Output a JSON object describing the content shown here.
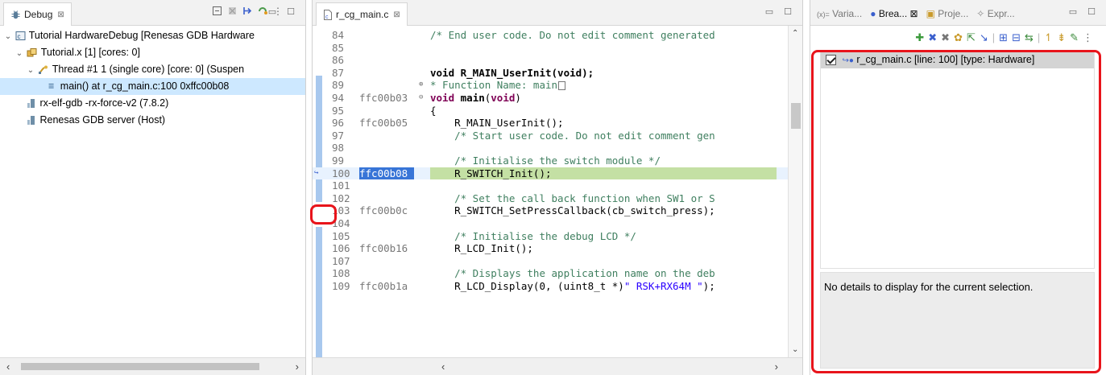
{
  "debug_view": {
    "tab_label": "Debug",
    "tab_close": "⊠",
    "toolbar_icons": [
      "collapse-all-icon",
      "remove-terminated-icon",
      "step-filters-icon",
      "connect-icon",
      "view-menu-icon"
    ],
    "tree": [
      {
        "label": "Tutorial HardwareDebug [Renesas GDB Hardware",
        "level": 0,
        "expanded": true,
        "icon": "launch-config-icon"
      },
      {
        "label": "Tutorial.x [1] [cores: 0]",
        "level": 1,
        "expanded": true,
        "icon": "process-icon"
      },
      {
        "label": "Thread #1 1 (single core) [core: 0] (Suspen",
        "level": 2,
        "expanded": true,
        "icon": "thread-icon"
      },
      {
        "label": "main() at r_cg_main.c:100 0xffc00b08",
        "level": 3,
        "selected": true,
        "icon": "stack-frame-icon"
      },
      {
        "label": "rx-elf-gdb -rx-force-v2 (7.8.2)",
        "level": 1,
        "icon": "debugger-process-icon"
      },
      {
        "label": "Renesas GDB server (Host)",
        "level": 1,
        "icon": "server-process-icon"
      }
    ]
  },
  "editor": {
    "tab_label": "r_cg_main.c",
    "tab_close": "⊠",
    "lines": [
      {
        "num": "84",
        "addr": "",
        "code": "/* End user code. Do not edit comment generated",
        "kind": "comment"
      },
      {
        "num": "85",
        "addr": "",
        "code": "",
        "kind": "plain"
      },
      {
        "num": "86",
        "addr": "",
        "code": "",
        "kind": "plain"
      },
      {
        "num": "87",
        "addr": "",
        "code": "void R_MAIN_UserInit(void);",
        "kind": "decl"
      },
      {
        "num": "89",
        "addr": "",
        "code": "* Function Name: main",
        "kind": "folded"
      },
      {
        "num": "94",
        "addr": "ffc00b03",
        "code": "void main(void)",
        "kind": "main"
      },
      {
        "num": "95",
        "addr": "",
        "code": "{",
        "kind": "plain"
      },
      {
        "num": "96",
        "addr": "ffc00b05",
        "code": "    R_MAIN_UserInit();",
        "kind": "plain"
      },
      {
        "num": "97",
        "addr": "",
        "code": "    /* Start user code. Do not edit comment gen",
        "kind": "comment"
      },
      {
        "num": "98",
        "addr": "",
        "code": "",
        "kind": "plain"
      },
      {
        "num": "99",
        "addr": "",
        "code": "    /* Initialise the switch module */",
        "kind": "comment"
      },
      {
        "num": "100",
        "addr": "ffc00b08",
        "code": "    R_SWITCH_Init();",
        "kind": "current"
      },
      {
        "num": "101",
        "addr": "",
        "code": "",
        "kind": "plain"
      },
      {
        "num": "102",
        "addr": "",
        "code": "    /* Set the call back function when SW1 or S",
        "kind": "comment"
      },
      {
        "num": "103",
        "addr": "ffc00b0c",
        "code": "    R_SWITCH_SetPressCallback(cb_switch_press);",
        "kind": "plain"
      },
      {
        "num": "104",
        "addr": "",
        "code": "",
        "kind": "plain"
      },
      {
        "num": "105",
        "addr": "",
        "code": "    /* Initialise the debug LCD */",
        "kind": "comment"
      },
      {
        "num": "106",
        "addr": "ffc00b16",
        "code": "    R_LCD_Init();",
        "kind": "plain"
      },
      {
        "num": "107",
        "addr": "",
        "code": "",
        "kind": "plain"
      },
      {
        "num": "108",
        "addr": "",
        "code": "    /* Displays the application name on the deb",
        "kind": "comment"
      },
      {
        "num": "109",
        "addr": "ffc00b1a",
        "code": "    R_LCD_Display(0, (uint8_t *)\" RSK+RX64M \");",
        "kind": "lcd"
      }
    ]
  },
  "right_view": {
    "tabs": [
      {
        "label": "Varia...",
        "active": false,
        "icon": "variables-icon"
      },
      {
        "label": "Brea...",
        "active": true,
        "icon": "breakpoints-icon"
      },
      {
        "label": "Proje...",
        "active": false,
        "icon": "project-icon"
      },
      {
        "label": "Expr...",
        "active": false,
        "icon": "expressions-icon"
      }
    ],
    "tab_close": "⊠",
    "breakpoint_label": "r_cg_main.c [line: 100] [type: Hardware]",
    "details_text": "No details to display for the current selection."
  },
  "window_controls": "▭ ☐",
  "colors": {
    "highlight": "#e8141b",
    "selection": "#cde8ff",
    "current_line": "#c4e0a4",
    "address_highlight": "#3875d7"
  }
}
